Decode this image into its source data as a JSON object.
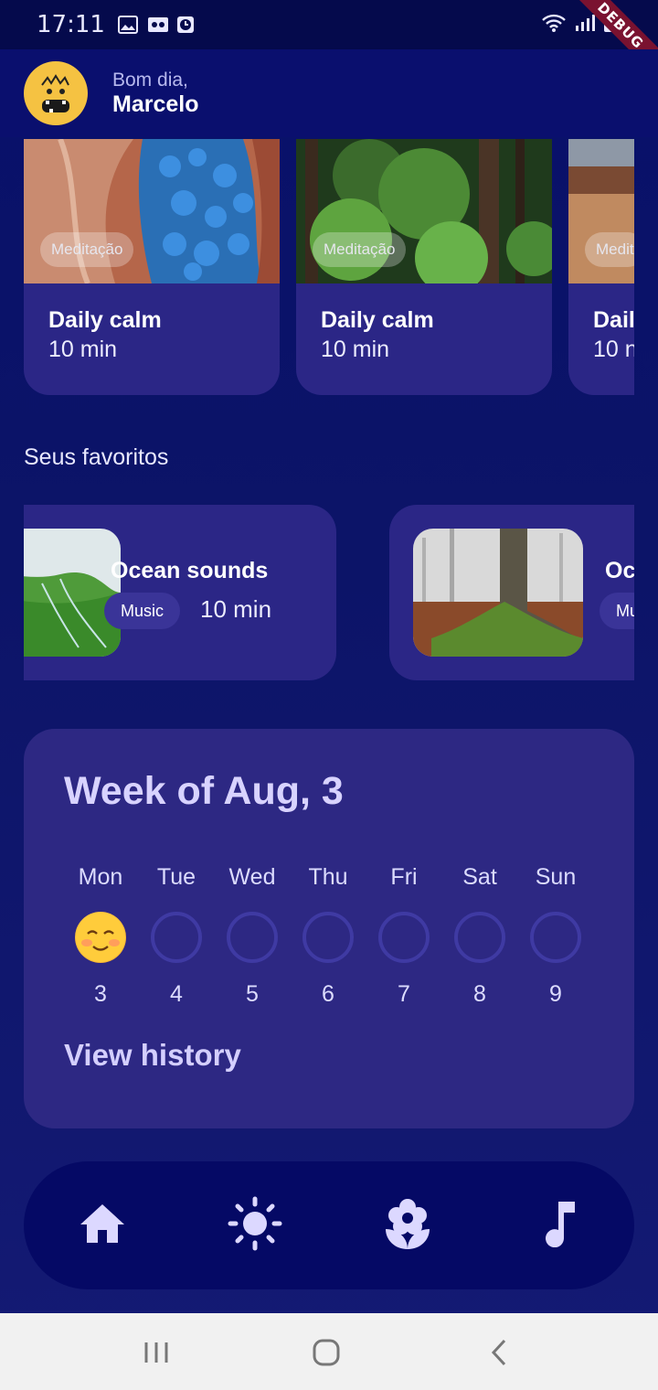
{
  "status_bar": {
    "time": "17:11",
    "debug_label": "DEBUG"
  },
  "header": {
    "greeting": "Bom dia,",
    "name": "Marcelo"
  },
  "featured": [
    {
      "tag": "Meditação",
      "title": "Daily calm",
      "duration": "10 min"
    },
    {
      "tag": "Meditação",
      "title": "Daily calm",
      "duration": "10 min"
    },
    {
      "tag": "Medit",
      "title": "Dail",
      "duration": "10 n"
    }
  ],
  "favorites": {
    "section_title": "Seus favoritos",
    "items": [
      {
        "title": "Ocean sounds",
        "chip": "Music",
        "duration": "10 min"
      },
      {
        "title": "Oc",
        "chip": "Mu",
        "duration": ""
      }
    ]
  },
  "week": {
    "title": "Week of Aug, 3",
    "days": [
      {
        "name": "Mon",
        "num": "3",
        "done": true
      },
      {
        "name": "Tue",
        "num": "4",
        "done": false
      },
      {
        "name": "Wed",
        "num": "5",
        "done": false
      },
      {
        "name": "Thu",
        "num": "6",
        "done": false
      },
      {
        "name": "Fri",
        "num": "7",
        "done": false
      },
      {
        "name": "Sat",
        "num": "8",
        "done": false
      },
      {
        "name": "Sun",
        "num": "9",
        "done": false
      }
    ],
    "view_history": "View history"
  },
  "bottom_nav": {
    "items": [
      "home-icon",
      "sun-icon",
      "flower-icon",
      "music-note-icon"
    ]
  },
  "colors": {
    "background": "#0c1468",
    "card": "#2b2686",
    "accent": "#d8d3ff"
  }
}
